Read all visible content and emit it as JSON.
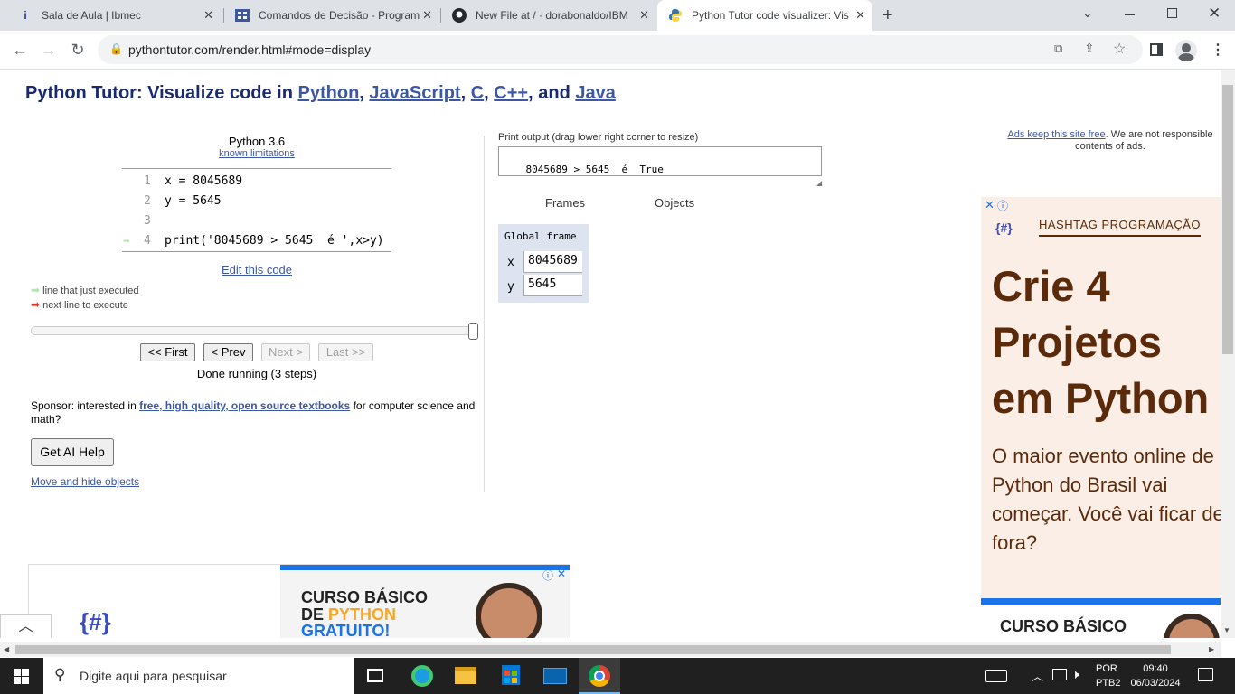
{
  "browser": {
    "tabs": [
      {
        "title": "Sala de Aula | Ibmec",
        "icon": "ibmec-icon"
      },
      {
        "title": "Comandos de Decisão - Program",
        "icon": "doc-icon"
      },
      {
        "title": "New File at / · dorabonaldo/IBM",
        "icon": "github-icon"
      },
      {
        "title": "Python Tutor code visualizer: Vis",
        "icon": "python-icon"
      }
    ],
    "url": "pythontutor.com/render.html#mode=display"
  },
  "page": {
    "heading_prefix": "Python Tutor: Visualize code in ",
    "heading_langs": [
      "Python",
      "JavaScript",
      "C",
      "C++",
      "Java"
    ],
    "sep_comma": ", ",
    "sep_and": ", and ",
    "python_version": "Python 3.6",
    "known_limitations": "known limitations",
    "code_lines": [
      {
        "num": "1",
        "code": "x = 8045689"
      },
      {
        "num": "2",
        "code": "y = 5645"
      },
      {
        "num": "3",
        "code": ""
      },
      {
        "num": "4",
        "code": "print('8045689 > 5645  é ',x>y)"
      }
    ],
    "edit_code": "Edit this code",
    "legend_executed": "line that just executed",
    "legend_next": "next line to execute",
    "nav": {
      "first": "<< First",
      "prev": "< Prev",
      "next": "Next >",
      "last": "Last >>"
    },
    "progress": 1.0,
    "status": "Done running (3 steps)",
    "sponsor_text": "Sponsor: interested in ",
    "sponsor_link": "free, high quality, open source textbooks",
    "sponsor_suffix": " for computer science and math?",
    "ai_help": "Get AI Help",
    "move_hide": "Move and hide objects",
    "print_label": "Print output (drag lower right corner to resize)",
    "print_output": "8045689 > 5645  é  True",
    "frames_label": "Frames",
    "objects_label": "Objects",
    "global_frame": "Global frame",
    "vars": [
      {
        "name": "x",
        "value": "8045689"
      },
      {
        "name": "y",
        "value": "5645"
      }
    ],
    "ads_link": "Ads keep this site free",
    "ads_text": ". We are not responsible contents of ads."
  },
  "ad_right": {
    "brand": "HASHTAG PROGRAMAÇÃO",
    "headline": "Crie 4 Projetos em Python",
    "body": "O maior evento online de Python do Brasil vai começar. Você vai ficar de fora?",
    "banner": "CURSO BÁSICO"
  },
  "ad_bottom": {
    "line1": "CURSO BÁSICO",
    "line2a": "DE ",
    "line2b": "PYTHON",
    "line3": "GRATUITO!"
  },
  "taskbar": {
    "search_placeholder": "Digite aqui para pesquisar",
    "lang1": "POR",
    "lang2": "PTB2",
    "time": "09:40",
    "date": "06/03/2024"
  },
  "colors": {
    "heading": "#1a2a6e",
    "link": "#3d58a2",
    "frame_bg": "#dde3ef",
    "ad_bg": "#fbeee6",
    "ad_brown": "#5b2a0a",
    "arrow_green": "#b6e3b0",
    "arrow_red": "#e0312d"
  }
}
